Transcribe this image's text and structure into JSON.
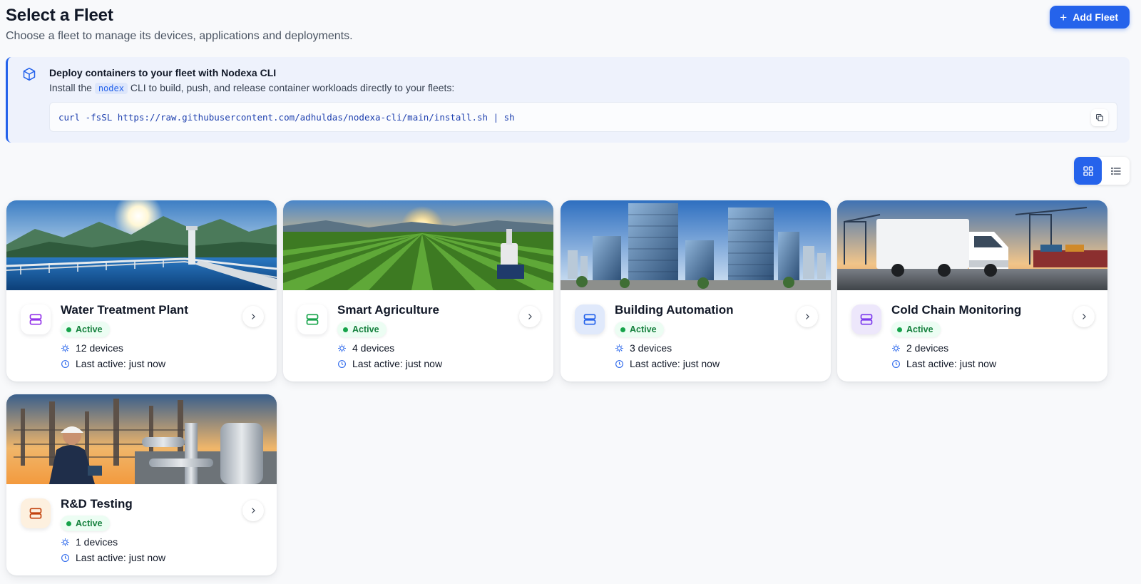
{
  "header": {
    "title": "Select a Fleet",
    "subtitle": "Choose a fleet to manage its devices, applications and deployments.",
    "add_button_label": "Add Fleet"
  },
  "banner": {
    "title": "Deploy containers to your fleet with Nodexa CLI",
    "desc_before": "Install the",
    "desc_code": "nodex",
    "desc_after": "CLI to build, push, and release container workload s directly to your fleets:",
    "command": "curl -fsSL https://raw.githubusercontent.com/adhuldas/nodexa-cli/main/install.sh | sh"
  },
  "view": {
    "selected": "grid"
  },
  "fleets": [
    {
      "name": "Water Treatment Plant",
      "status": "Active",
      "devices": "12 devices",
      "last_active": "Last active: just now",
      "icon_color": "#9333ea",
      "icon_bg": "#ffffff"
    },
    {
      "name": "Smart Agriculture",
      "status": "Active",
      "devices": "4 devices",
      "last_active": "Last active: just now",
      "icon_color": "#16a34a",
      "icon_bg": "#ffffff"
    },
    {
      "name": "Building Automation",
      "status": "Active",
      "devices": "3 devices",
      "last_active": "Last active: just now",
      "icon_color": "#2563eb",
      "icon_bg": "#e0e9fb"
    },
    {
      "name": "Cold Chain Monitoring",
      "status": "Active",
      "devices": "2 devices",
      "last_active": "Last active: just now",
      "icon_color": "#7c3aed",
      "icon_bg": "#ede7fb"
    },
    {
      "name": "R&D Testing",
      "status": "Active",
      "devices": "1 devices",
      "last_active": "Last active: just now",
      "icon_color": "#c2410c",
      "icon_bg": "#fdf0df"
    }
  ],
  "colors": {
    "accent": "#2563eb",
    "active_text": "#15803d",
    "active_bg": "#ecfdf3"
  }
}
